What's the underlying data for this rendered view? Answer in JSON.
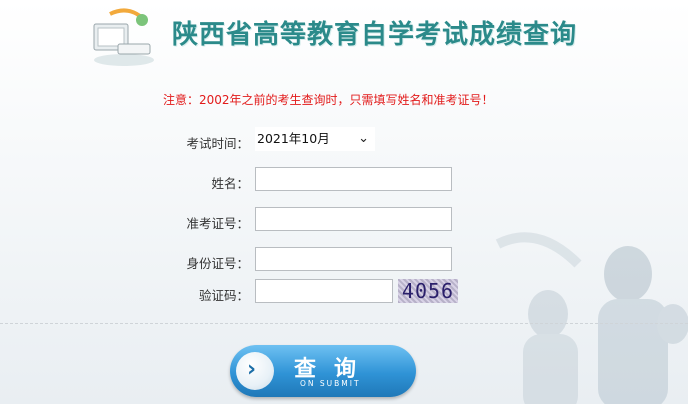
{
  "header": {
    "title": "陕西省高等教育自学考试成绩查询"
  },
  "notice": "注意：2002年之前的考生查询时，只需填写姓名和准考证号！",
  "form": {
    "exam_time_label": "考试时间：",
    "exam_time_value": "2021年10月",
    "name_label": "姓名：",
    "ticket_label": "准考证号：",
    "id_label": "身份证号：",
    "captcha_label": "验证码：",
    "captcha_text": "4056"
  },
  "button": {
    "label": "查询",
    "sub_label": "ON SUBMIT"
  }
}
